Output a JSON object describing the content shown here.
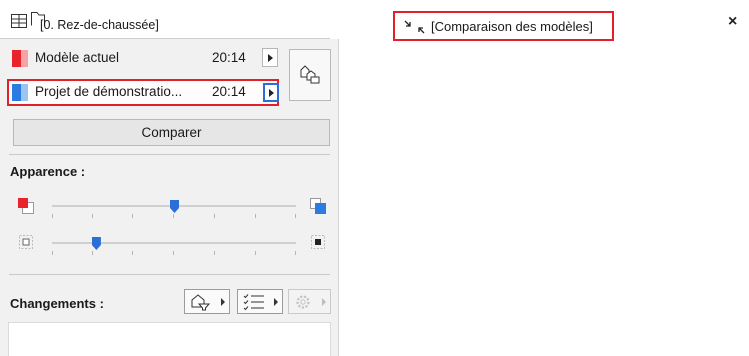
{
  "header": {
    "floor_label": "[0. Rez-de-chaussée]",
    "view_icons": [
      "grid-layout-icon",
      "folder-icon"
    ]
  },
  "tab": {
    "label": "[Comparaison des modèles]",
    "icon": "compare-arrows-icon",
    "close_label": "×"
  },
  "models": [
    {
      "name": "Modèle actuel",
      "time": "20:14",
      "color": "#e8232a"
    },
    {
      "name": "Projet de démonstratio...",
      "time": "20:14",
      "color": "#2b7be0"
    }
  ],
  "compare_button": "Comparer",
  "appearance": {
    "title": "Apparence :",
    "sliders": [
      {
        "name": "color-blend",
        "level": 0.5,
        "left_icon": "red-overlay-icon",
        "right_icon": "blue-overlay-icon"
      },
      {
        "name": "opacity",
        "level": 0.18,
        "left_icon": "transparent-square-icon",
        "right_icon": "solid-square-icon"
      }
    ]
  },
  "changes": {
    "title": "Changements :",
    "buttons": [
      "filter-shapes-icon",
      "checklist-icon",
      "settings-gear-icon"
    ]
  }
}
